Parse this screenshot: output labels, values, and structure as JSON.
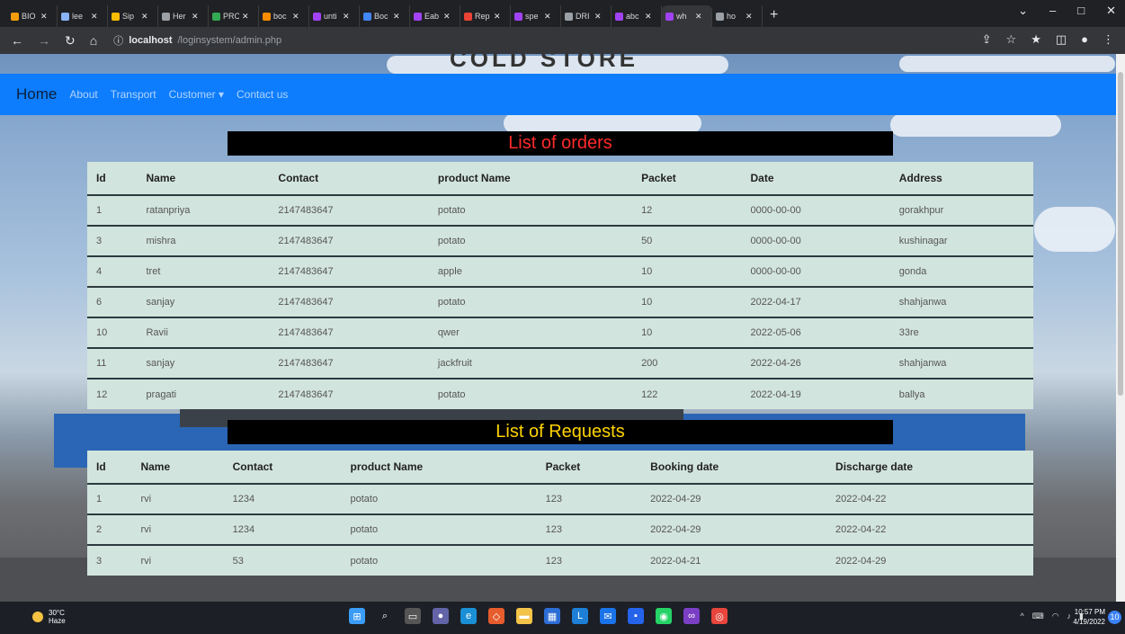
{
  "browser": {
    "tabs": [
      {
        "label": "BIO",
        "color": "#f59e0b"
      },
      {
        "label": "lee",
        "color": "#8ab4f8"
      },
      {
        "label": "Sip",
        "color": "#fbbc04"
      },
      {
        "label": "Her",
        "color": "#9aa0a6"
      },
      {
        "label": "PRO",
        "color": "#34a853"
      },
      {
        "label": "boc",
        "color": "#fb8c00"
      },
      {
        "label": "unti",
        "color": "#a142f4"
      },
      {
        "label": "Boc",
        "color": "#4285f4"
      },
      {
        "label": "Eab",
        "color": "#a142f4"
      },
      {
        "label": "Rep",
        "color": "#ea4335"
      },
      {
        "label": "spe",
        "color": "#a142f4"
      },
      {
        "label": "DRI",
        "color": "#9aa0a6"
      },
      {
        "label": "abc",
        "color": "#a142f4"
      },
      {
        "label": "wh",
        "color": "#a142f4"
      },
      {
        "label": "ho",
        "color": "#9aa0a6"
      }
    ],
    "new_tab": "+",
    "url_host": "localhost",
    "url_path": "/loginsystem/admin.php"
  },
  "site": {
    "banner": "COLD STORE",
    "nav": {
      "brand": "Home",
      "links": [
        "About",
        "Transport",
        "Customer ▾",
        "Contact us"
      ]
    }
  },
  "orders": {
    "title": "List of orders",
    "columns": [
      "Id",
      "Name",
      "Contact",
      "product Name",
      "Packet",
      "Date",
      "Address"
    ],
    "rows": [
      [
        "1",
        "ratanpriya",
        "2147483647",
        "potato",
        "12",
        "0000-00-00",
        "gorakhpur"
      ],
      [
        "3",
        "mishra",
        "2147483647",
        "potato",
        "50",
        "0000-00-00",
        "kushinagar"
      ],
      [
        "4",
        "tret",
        "2147483647",
        "apple",
        "10",
        "0000-00-00",
        "gonda"
      ],
      [
        "6",
        "sanjay",
        "2147483647",
        "potato",
        "10",
        "2022-04-17",
        "shahjanwa"
      ],
      [
        "10",
        "Ravii",
        "2147483647",
        "qwer",
        "10",
        "2022-05-06",
        "33re"
      ],
      [
        "11",
        "sanjay",
        "2147483647",
        "jackfruit",
        "200",
        "2022-04-26",
        "shahjanwa"
      ],
      [
        "12",
        "pragati",
        "2147483647",
        "potato",
        "122",
        "2022-04-19",
        "ballya"
      ]
    ]
  },
  "requests": {
    "title": "List of Requests",
    "columns": [
      "Id",
      "Name",
      "Contact",
      "product Name",
      "Packet",
      "Booking date",
      "Discharge date"
    ],
    "rows": [
      [
        "1",
        "rvi",
        "1234",
        "potato",
        "123",
        "2022-04-29",
        "2022-04-22"
      ],
      [
        "2",
        "rvi",
        "1234",
        "potato",
        "123",
        "2022-04-29",
        "2022-04-22"
      ],
      [
        "3",
        "rvi",
        "53",
        "potato",
        "123",
        "2022-04-21",
        "2022-04-29"
      ]
    ]
  },
  "taskbar": {
    "weather_temp": "30°C",
    "weather_desc": "Haze",
    "time": "10:57 PM",
    "date": "4/19/2022",
    "notifications": "10"
  }
}
